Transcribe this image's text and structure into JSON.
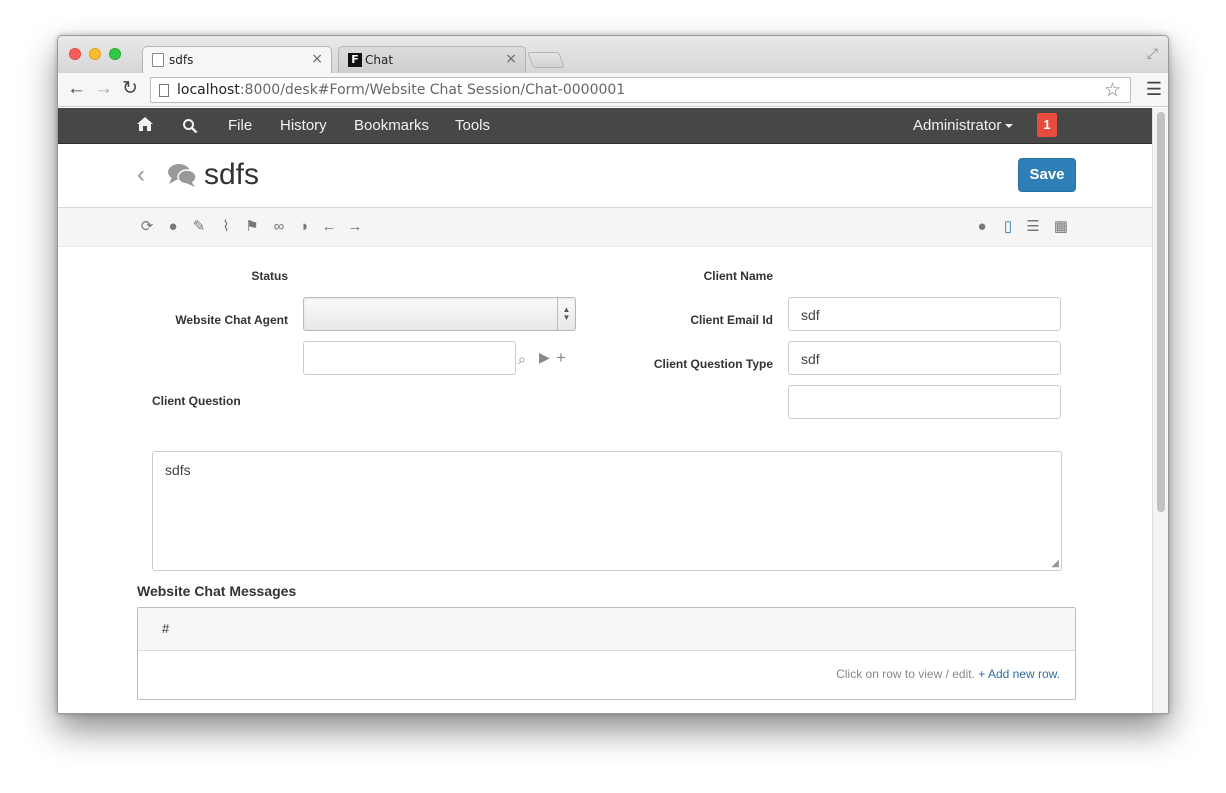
{
  "browser": {
    "tabs": [
      {
        "label": "sdfs",
        "active": true
      },
      {
        "label": "Chat",
        "active": false
      }
    ],
    "url_host": "localhost",
    "url_path": ":8000/desk#Form/Website Chat Session/Chat-0000001"
  },
  "navbar": {
    "items": [
      "File",
      "History",
      "Bookmarks",
      "Tools"
    ],
    "user": "Administrator",
    "notification_count": "1"
  },
  "page": {
    "title": "sdfs",
    "save_label": "Save"
  },
  "form": {
    "status_label": "Status",
    "status_value": "",
    "agent_label": "Website Chat Agent",
    "agent_value": "",
    "client_name_label": "Client Name",
    "client_name_value": "sdf",
    "client_email_label": "Client Email Id",
    "client_email_value": "sdf",
    "question_type_label": "Client Question Type",
    "question_type_value": "",
    "question_label": "Client Question",
    "question_value": "sdfs"
  },
  "messages": {
    "section_title": "Website Chat Messages",
    "column_hash": "#",
    "footer_text": "Click on row to view / edit.",
    "add_row": "+ Add new row."
  },
  "colors": {
    "navbar_bg": "#474747",
    "save_button": "#2e7fb8",
    "badge": "#e74c3c"
  }
}
